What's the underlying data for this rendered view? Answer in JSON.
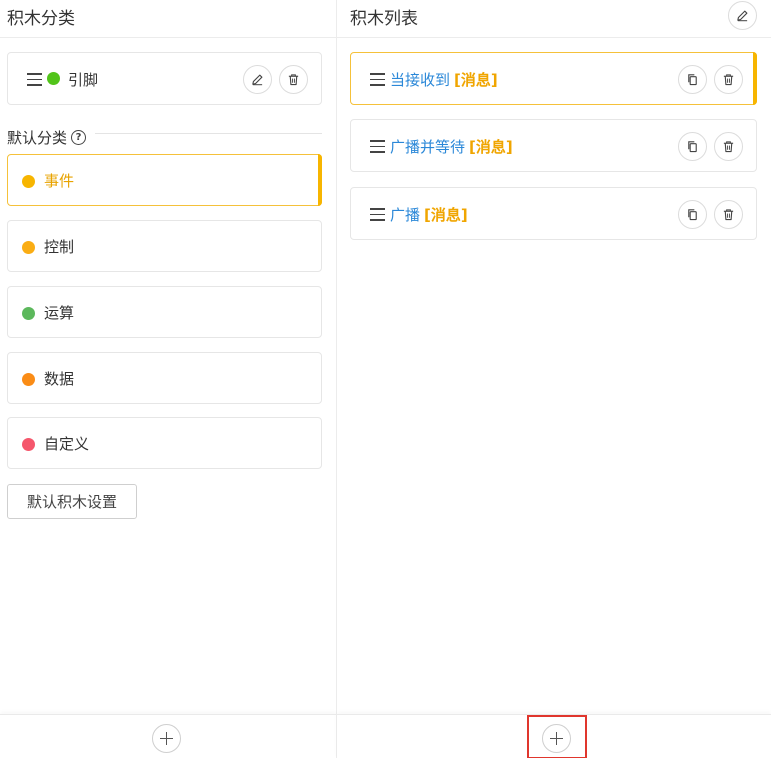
{
  "left_panel": {
    "title": "积木分类",
    "script": {
      "label": "引脚",
      "dot_color": "#52c41a"
    },
    "section_title": "默认分类",
    "categories": [
      {
        "label": "事件",
        "color": "#f7b500",
        "active": true
      },
      {
        "label": "控制",
        "color": "#faad14",
        "active": false
      },
      {
        "label": "运算",
        "color": "#5cb85c",
        "active": false
      },
      {
        "label": "数据",
        "color": "#fa8c16",
        "active": false
      },
      {
        "label": "自定义",
        "color": "#f5576c",
        "active": false
      }
    ],
    "default_settings_label": "默认积木设置"
  },
  "right_panel": {
    "title": "积木列表",
    "blocks": [
      {
        "name": "当接收到",
        "tag": "[消息]",
        "active": true
      },
      {
        "name": "广播并等待",
        "tag": "[消息]",
        "active": false
      },
      {
        "name": "广播",
        "tag": "[消息]",
        "active": false
      }
    ]
  },
  "icons": {
    "drag": "drag-handle-icon",
    "edit": "pencil-icon",
    "delete": "trash-icon",
    "copy": "copy-icon",
    "add": "plus-icon",
    "help": "question-circle-icon"
  },
  "colors": {
    "accent": "#f7b500",
    "link": "#2b88d8",
    "highlight": "#e0362d"
  }
}
